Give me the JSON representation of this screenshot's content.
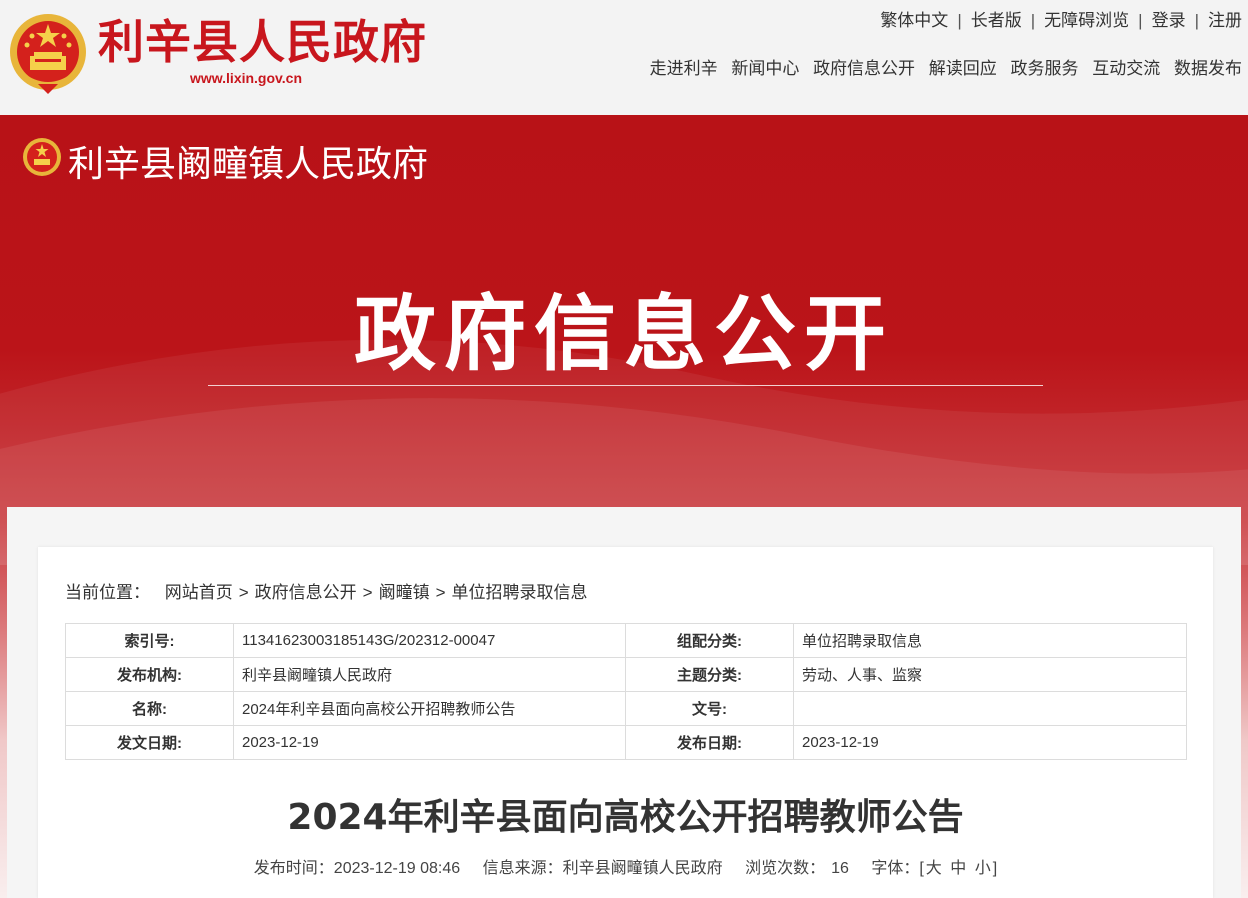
{
  "site": {
    "title": "利辛县人民政府",
    "url": "www.lixin.gov.cn",
    "brand_color": "#c8161d"
  },
  "utility_links": [
    "繁体中文",
    "长者版",
    "无障碍浏览",
    "登录",
    "注册"
  ],
  "main_nav": [
    "走进利辛",
    "新闻中心",
    "政府信息公开",
    "解读回应",
    "政务服务",
    "互动交流",
    "数据发布"
  ],
  "banner": {
    "town_name": "利辛县阚疃镇人民政府",
    "heading": "政府信息公开",
    "color": "#b81217"
  },
  "breadcrumb": {
    "label": "当前位置：",
    "items": [
      "网站首页",
      "政府信息公开",
      "阚疃镇",
      "单位招聘录取信息"
    ],
    "separator": ">"
  },
  "meta_table": {
    "rows": [
      {
        "k1": "索引号:",
        "v1": "11341623003185143G/202312-00047",
        "k2": "组配分类:",
        "v2": "单位招聘录取信息"
      },
      {
        "k1": "发布机构:",
        "v1": "利辛县阚疃镇人民政府",
        "k2": "主题分类:",
        "v2": "劳动、人事、监察"
      },
      {
        "k1": "名称:",
        "v1": "2024年利辛县面向高校公开招聘教师公告",
        "k2": "文号:",
        "v2": ""
      },
      {
        "k1": "发文日期:",
        "v1": "2023-12-19",
        "k2": "发布日期:",
        "v2": "2023-12-19"
      }
    ]
  },
  "article": {
    "title": "2024年利辛县面向高校公开招聘教师公告",
    "publish_time_label": "发布时间：",
    "publish_time": "2023-12-19 08:46",
    "source_label": "信息来源：",
    "source": "利辛县阚疃镇人民政府",
    "views_label": "浏览次数：",
    "views": "16",
    "font_label": "字体：",
    "font_open": "[",
    "font_sizes": [
      "大",
      "中",
      "小"
    ],
    "font_close": "]"
  }
}
